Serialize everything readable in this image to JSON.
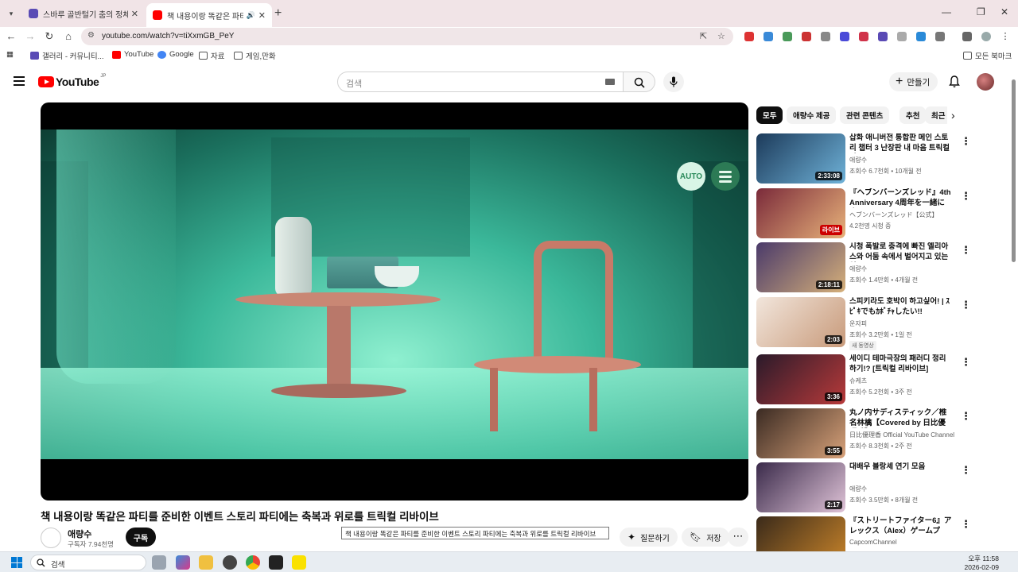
{
  "browser": {
    "tabs": [
      {
        "title": "스바루 골반털기 춤의 정체 - 유",
        "active": false
      },
      {
        "title": "책 내용이랑 똑같은 파티를",
        "active": true
      }
    ],
    "url": "youtube.com/watch?v=tiXxmGB_PeY",
    "bookmarks": [
      "갤러리 - 커뮤니티...",
      "YouTube",
      "Google",
      "자료",
      "게임,만화"
    ],
    "all_bookmarks": "모든 북마크"
  },
  "youtube": {
    "logo_region": "JP",
    "logo_text": "YouTube",
    "search_placeholder": "검색",
    "create_label": "만들기"
  },
  "player": {
    "auto_label": "AUTO"
  },
  "video": {
    "title": "책 내용이랑 똑같은 파티를 준비한 이벤트 스토리 파티에는 축복과 위로를 트릭컬 리바이브",
    "tooltip": "책 내용이랑 똑같은 파티를 준비한 이벤트 스토리 파티에는 축복과 위로를 트릭컬 리바이브",
    "channel": "애량수",
    "subscribers": "구독자 7.94천명",
    "subscribe_label": "구독",
    "ask_label": "질문하기",
    "save_label": "저장"
  },
  "chips": [
    "모두",
    "애량수 제공",
    "관련 콘텐츠",
    "추천",
    "최근"
  ],
  "recommendations": [
    {
      "title": "삽화 애니버전 통합판 메인 스토리 챕터 3 난장판 내 마음 트릭컬 리...",
      "channel": "애량수",
      "meta": "조회수 6.7천회 • 10개월 전",
      "duration": "2:33:08",
      "thumb": [
        "#1c3a5a",
        "#6fb2d8"
      ]
    },
    {
      "title": "『ヘブンバーンズレッド』4th Anniversary 4周年を一緒に迎...",
      "channel": "ヘブンバーンズレッド【公式】",
      "meta": "4.2천명 시청 중",
      "live": "라이브",
      "thumb": [
        "#7a2a3a",
        "#e8b27a"
      ]
    },
    {
      "title": "시청 폭발로 충격에 빠진 엘리아스와 어둠 속에서 벌어지고 있는 일...",
      "channel": "애량수",
      "meta": "조회수 1.4만회 • 4개월 전",
      "duration": "2:18:11",
      "thumb": [
        "#4a3a6a",
        "#d6b07a"
      ]
    },
    {
      "title": "스피키라도 호박이 하고싶어! | ｽﾋﾟｷでもｶﾎﾞﾁｬしたい!!",
      "channel": "운자피",
      "meta": "조회수 3.2만회 • 1일 전",
      "badge": "새 동영상",
      "duration": "2:03",
      "thumb": [
        "#f2e6dc",
        "#c89a7a"
      ]
    },
    {
      "title": "세이디 테마극장의 패러디 정리하기!? [트릭컬 리바이브]",
      "channel": "슈케츠",
      "meta": "조회수 5.2천회 • 3주 전",
      "duration": "3:36",
      "thumb": [
        "#2a1a2a",
        "#b83a3a"
      ]
    },
    {
      "title": "丸ノ内サディスティック／椎名林檎【Covered by 日比優理香】",
      "channel": "日比優理香 Official YouTube Channel",
      "meta": "조회수 8.3천회 • 2주 전",
      "duration": "3:55",
      "thumb": [
        "#3a2a22",
        "#d8a27a"
      ]
    },
    {
      "title": "대배우 블랑셰 연기 모음",
      "channel": "애량수",
      "meta": "조회수 3.5만회 • 8개월 전",
      "duration": "2:17",
      "thumb": [
        "#3a2a4a",
        "#e0c4d8"
      ]
    },
    {
      "title": "『ストリートファイター6』アレックス（Alex）ゲームプレ...",
      "channel": "CapcomChannel",
      "meta": "",
      "thumb": [
        "#3a2a1a",
        "#c8842a"
      ]
    }
  ],
  "taskbar": {
    "search_label": "검색",
    "time": "오후 11:58",
    "date": "2026-02-09"
  },
  "colors": {
    "tabstrip": "#f1e4e7",
    "yt_red": "#ff0000",
    "scene_teal": "#3bb89a"
  }
}
